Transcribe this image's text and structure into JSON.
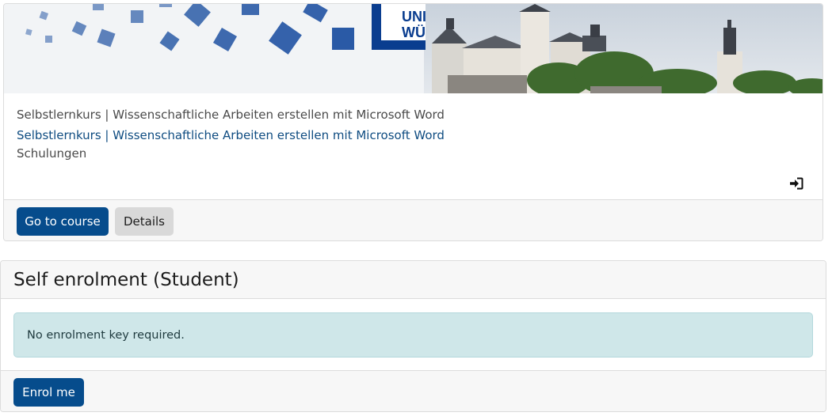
{
  "course": {
    "fullname": "Selbstlernkurs | Wissenschaftliche Arbeiten erstellen mit Microsoft Word",
    "link_text": "Selbstlernkurs | Wissenschaftliche Arbeiten erstellen mit Microsoft Word",
    "category": "Schulungen",
    "banner_logo_text_line1": "UNI",
    "banner_logo_text_line2": "WÜ",
    "go_to_course_label": "Go to course",
    "details_label": "Details",
    "enrol_icon": "sign-in-icon"
  },
  "enrolment": {
    "title": "Self enrolment (Student)",
    "notice": "No enrolment key required.",
    "enrol_button_label": "Enrol me"
  },
  "colors": {
    "primary": "#064c8c",
    "link": "#0f4c81",
    "alert_bg": "#cfe7e9"
  }
}
